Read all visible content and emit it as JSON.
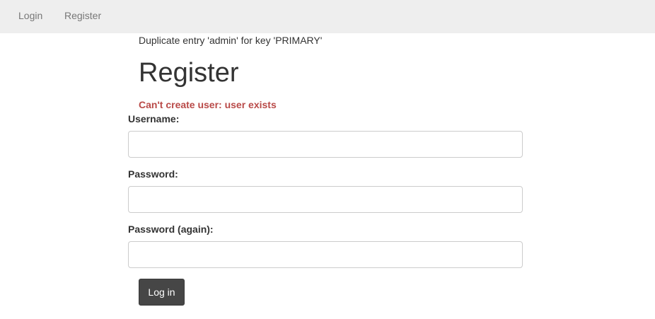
{
  "nav": {
    "login_label": "Login",
    "register_label": "Register"
  },
  "db_error": "Duplicate entry 'admin' for key 'PRIMARY'",
  "page_title": "Register",
  "error_message": "Can't create user: user exists",
  "form": {
    "username_label": "Username:",
    "username_value": "",
    "password_label": "Password:",
    "password_value": "",
    "password_again_label": "Password (again):",
    "password_again_value": "",
    "submit_label": "Log in"
  },
  "colors": {
    "navbar_bg": "#eeeeee",
    "nav_link": "#777777",
    "error_text": "#b94a48",
    "button_bg": "#464646",
    "button_text": "#ffffff"
  }
}
